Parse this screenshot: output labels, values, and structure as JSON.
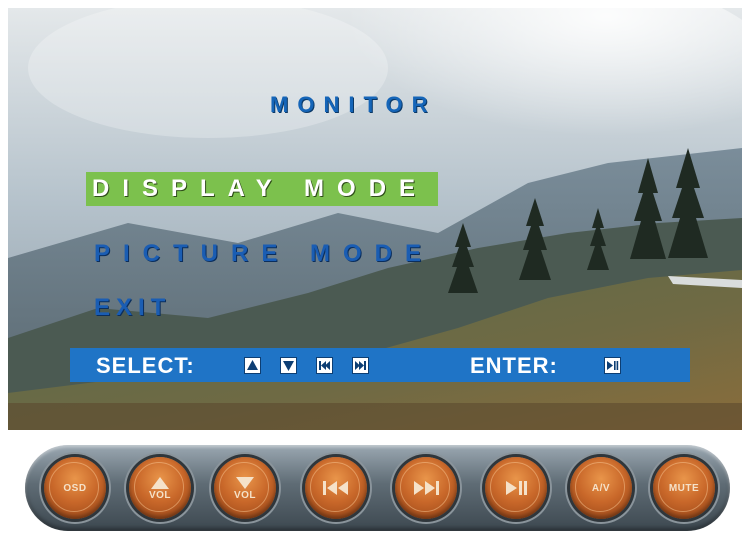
{
  "osd": {
    "title": "MONITOR",
    "menu": [
      {
        "label": "DISPLAY MODE",
        "selected": true
      },
      {
        "label": "PICTURE MODE",
        "selected": false
      },
      {
        "label": "EXIT",
        "selected": false
      }
    ],
    "select_label": "SELECT:",
    "enter_label": "ENTER:",
    "select_keys": [
      "up-arrow-icon",
      "down-arrow-icon",
      "prev-track-icon",
      "next-track-icon"
    ],
    "enter_key": "play-pause-icon",
    "colors": {
      "title": "#1565b8",
      "selected_bg": "#7cc14d",
      "menu_text": "#1a5db3",
      "bar_bg": "#1f74c6"
    }
  },
  "remote": {
    "buttons": [
      {
        "name": "osd-button",
        "label": "OSD"
      },
      {
        "name": "vol-up-button",
        "label": "VOL",
        "icon": "up-triangle-icon"
      },
      {
        "name": "vol-down-button",
        "label": "VOL",
        "icon": "down-triangle-icon"
      },
      {
        "name": "previous-button",
        "icon": "previous-track-icon"
      },
      {
        "name": "next-button",
        "icon": "next-track-icon"
      },
      {
        "name": "play-pause-button",
        "icon": "play-pause-icon"
      },
      {
        "name": "av-button",
        "label": "A/V"
      },
      {
        "name": "mute-button",
        "label": "MUTE"
      }
    ],
    "colors": {
      "button": "#c9682a",
      "strip": "#5f6c75"
    }
  }
}
